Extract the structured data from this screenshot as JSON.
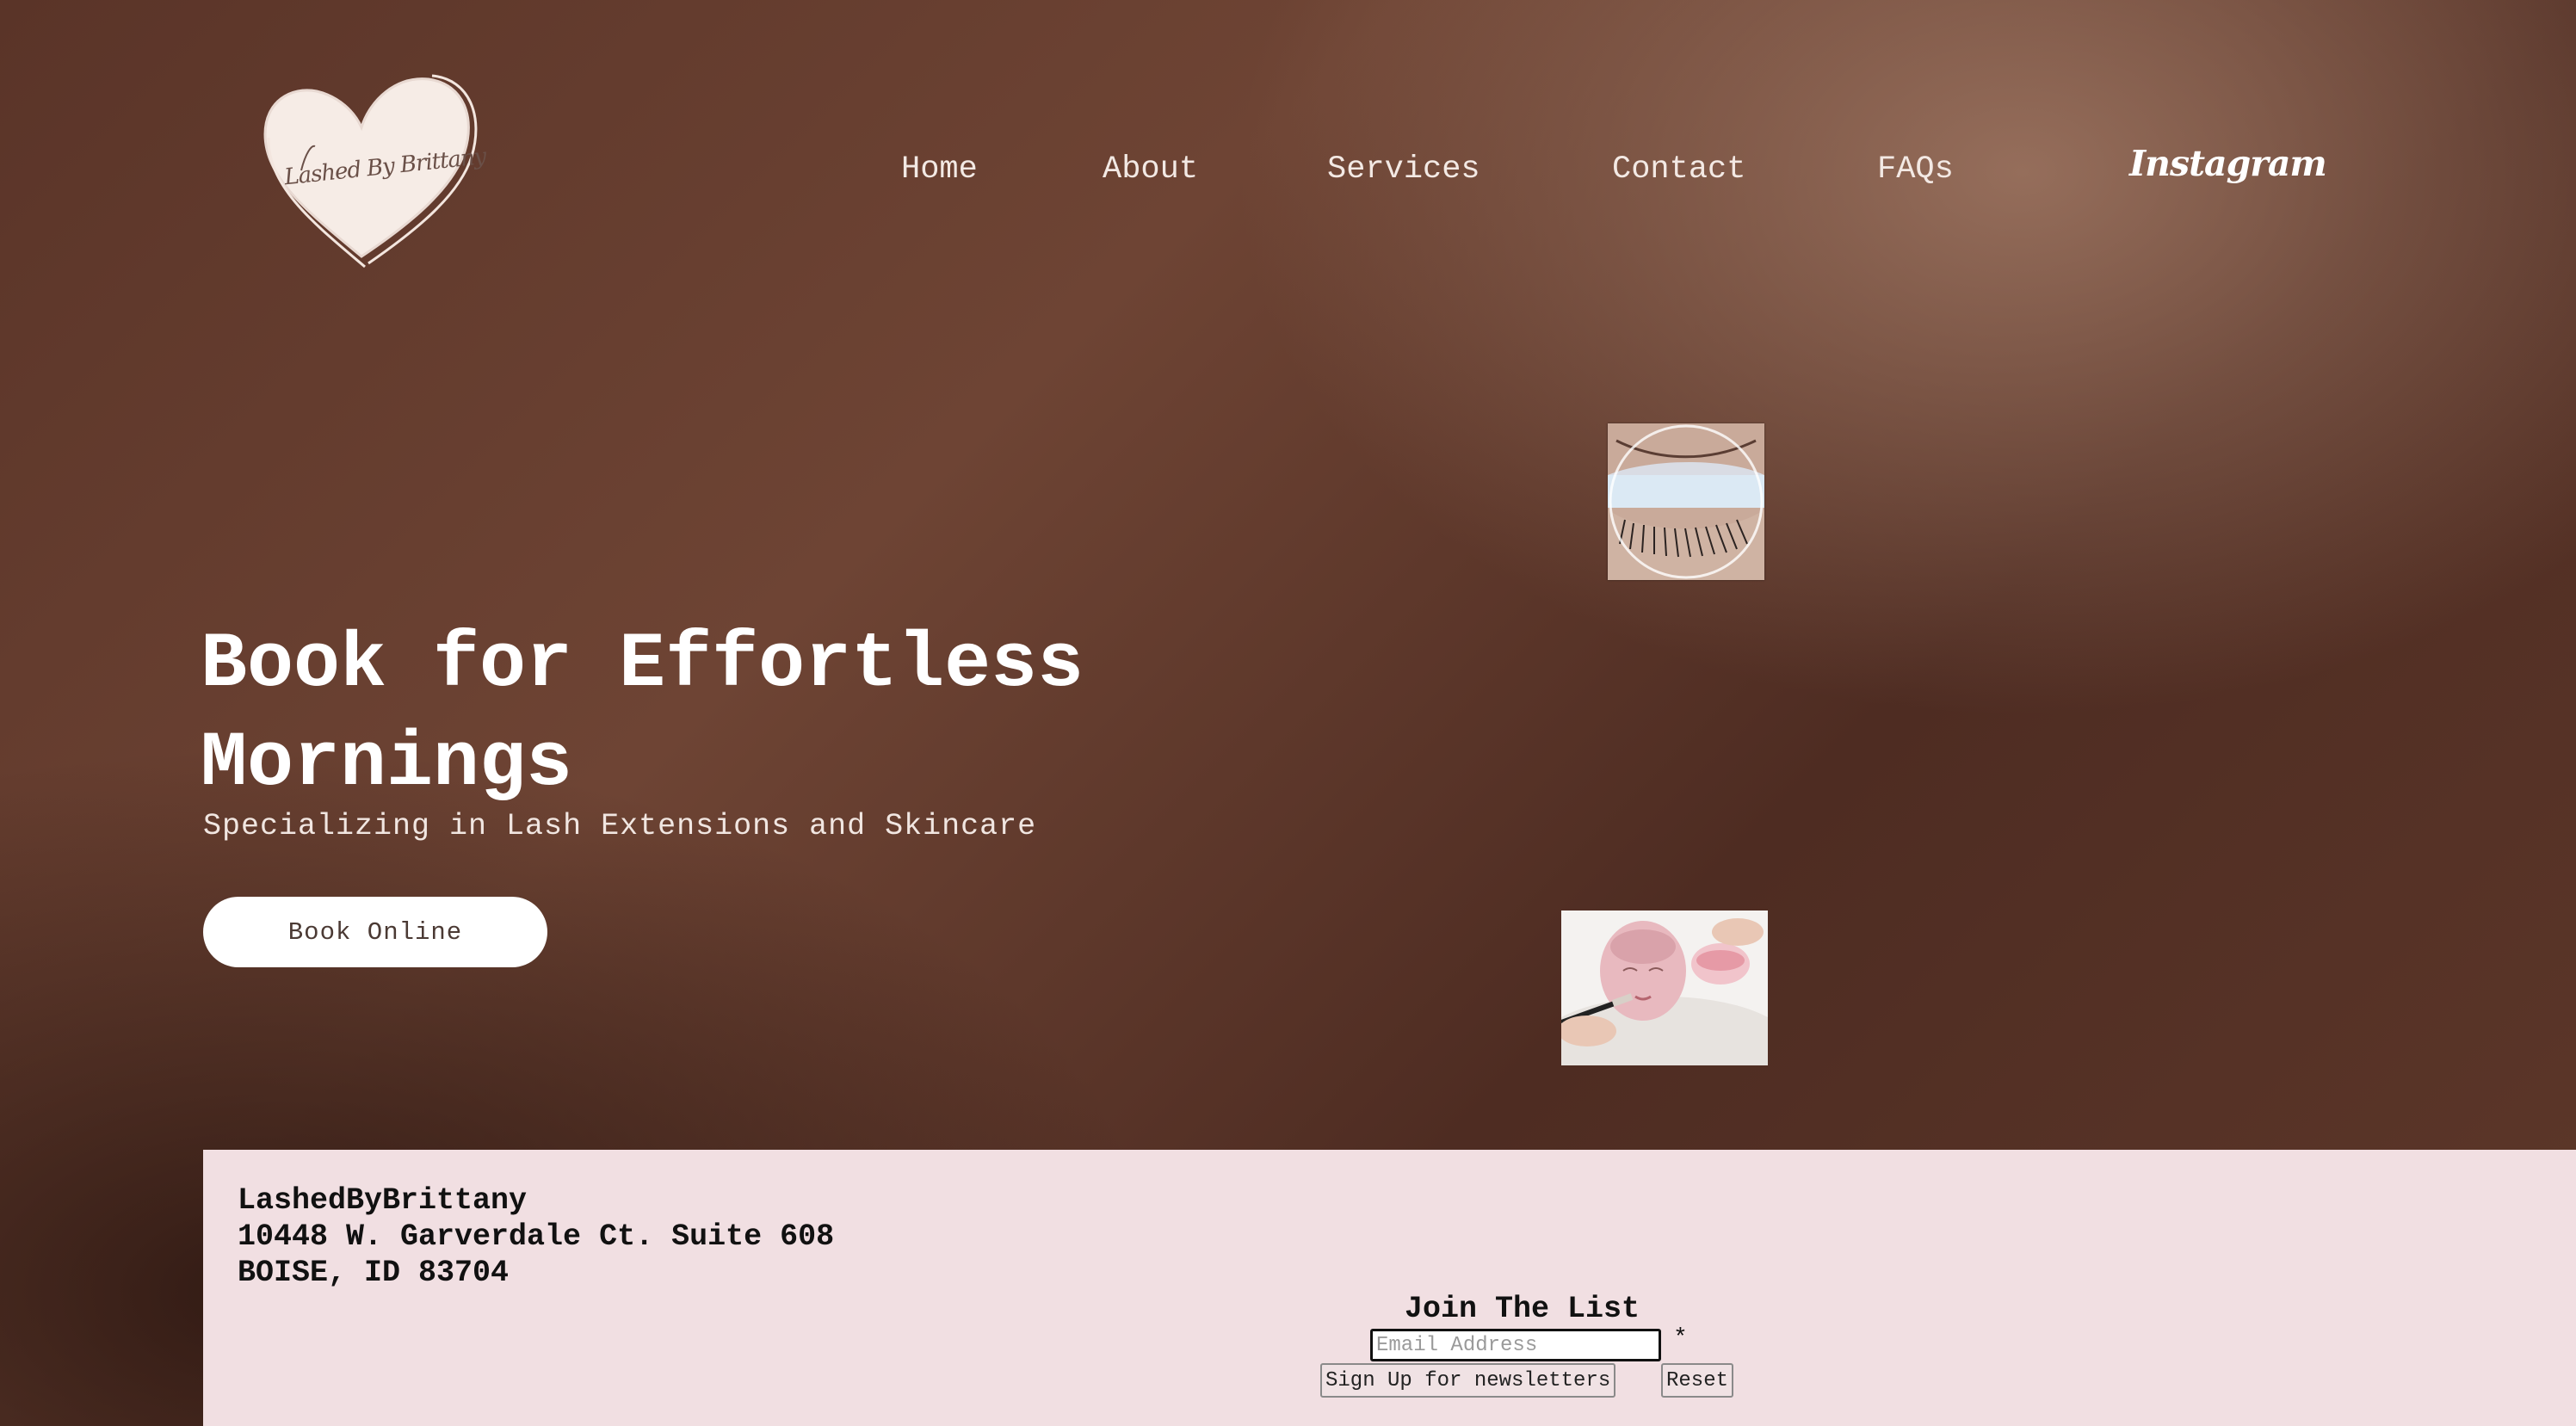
{
  "brand": {
    "logo_text": "Lashed By Brittany"
  },
  "nav": {
    "items": [
      {
        "label": "Home"
      },
      {
        "label": "About"
      },
      {
        "label": "Services"
      },
      {
        "label": "Contact"
      },
      {
        "label": "FAQs"
      }
    ],
    "social_label": "Instagram"
  },
  "hero": {
    "headline": "Book for Effortless Mornings",
    "subheadline": "Specializing in Lash Extensions and Skincare",
    "cta_label": "Book Online"
  },
  "footer": {
    "business_name": "LashedByBrittany",
    "address_line1": "10448 W. Garverdale Ct. Suite 608",
    "address_line2": "BOISE, ID 83704",
    "newsletter": {
      "title": "Join The List",
      "email_placeholder": "Email Address",
      "required_mark": "*",
      "signup_label": "Sign Up for newsletters",
      "reset_label": "Reset"
    }
  },
  "colors": {
    "footer_bg": "#f1dfe2",
    "hero_dark": "#4a2a20",
    "hero_light": "#9a7464",
    "cta_bg": "#ffffff"
  }
}
